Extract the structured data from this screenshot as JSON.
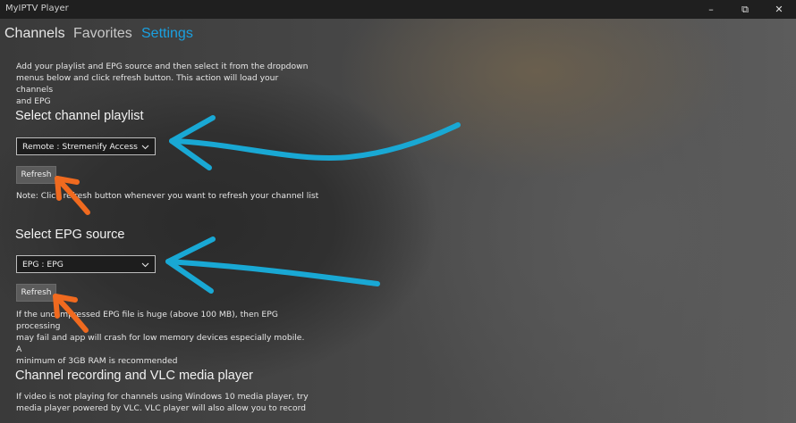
{
  "window": {
    "title": "MyIPTV Player",
    "controls": {
      "minimize": "–",
      "maximize": "⧉",
      "close": "✕"
    }
  },
  "tabs": [
    {
      "label": "Channels"
    },
    {
      "label": "Favorites"
    },
    {
      "label": "Settings",
      "active": true
    }
  ],
  "intro": {
    "line1": "Add your playlist and EPG source and then select it from the dropdown",
    "line2": "menus below and click refresh button. This action will load your channels",
    "line3": "and EPG"
  },
  "playlist": {
    "title": "Select channel playlist",
    "selected": "Remote : Stremenify Access",
    "refresh_label": "Refresh",
    "note": "Note: Click refresh button whenever you want to refresh your channel list"
  },
  "epg": {
    "title": "Select EPG source",
    "selected": "EPG : EPG",
    "refresh_label": "Refresh",
    "note_line1": "If the uncompressed EPG file is huge (above 100 MB), then EPG processing",
    "note_line2": "may fail and app will crash for low memory devices especially mobile. A",
    "note_line3": "minimum of 3GB RAM is recommended"
  },
  "recording": {
    "title": "Channel recording and VLC media player",
    "line1": "If video is not playing for channels using Windows 10 media player, try",
    "line2": "media player powered by VLC. VLC player will also allow you to record"
  },
  "colors": {
    "accent": "#1aa0e0",
    "arrow_blue": "#19a8d4",
    "arrow_orange": "#f06a1f"
  },
  "icons": {
    "dropdown": "chevron-down-icon"
  }
}
